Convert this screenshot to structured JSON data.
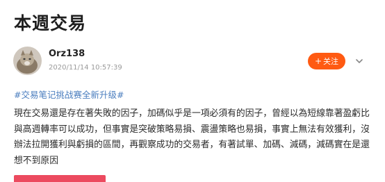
{
  "post": {
    "title": "本週交易",
    "author": {
      "name": "Orz138",
      "timestamp": "2020/11/14 10:57:39"
    },
    "follow_label": "关注",
    "follow_icon": "plus-icon",
    "more_icon": "chevron-down-icon",
    "hashtag": "#交易笔记挑战赛全新升级#",
    "body": "現在交易還是存在著失敗的因子，加碼似乎是一項必須有的因子，曾經以為短線靠著盈虧比與高週轉率可以成功，但事實是突破策略易損、震盪策略也易損，事實上無法有效獲利，沒辦法拉開獲利與虧損的區間，再觀察成功的交易者，有著試單、加碼、減碼，減碼實在是還想不到原因"
  },
  "colors": {
    "accent": "#ff5a12",
    "hashtag": "#4a7dbe",
    "bottom_bar": "#ec4a5f"
  }
}
